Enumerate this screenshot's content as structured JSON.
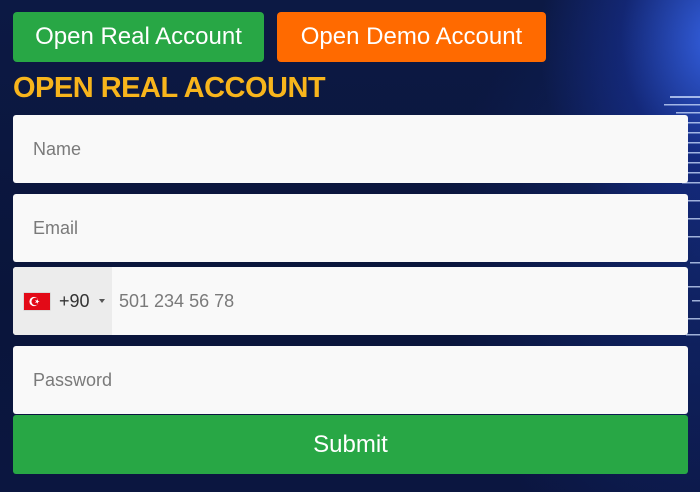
{
  "tabs": {
    "real_label": "Open Real Account",
    "demo_label": "Open Demo Account"
  },
  "form": {
    "heading": "OPEN REAL ACCOUNT",
    "name_placeholder": "Name",
    "email_placeholder": "Email",
    "phone": {
      "country_flag": "turkey-flag-icon",
      "dial_code": "+90",
      "placeholder": "501 234 56 78"
    },
    "password_placeholder": "Password",
    "submit_label": "Submit"
  },
  "colors": {
    "real_button": "#28a745",
    "demo_button": "#ff6a00",
    "heading": "#f8b51c",
    "background": "#0b1640",
    "submit_button": "#28a745"
  }
}
